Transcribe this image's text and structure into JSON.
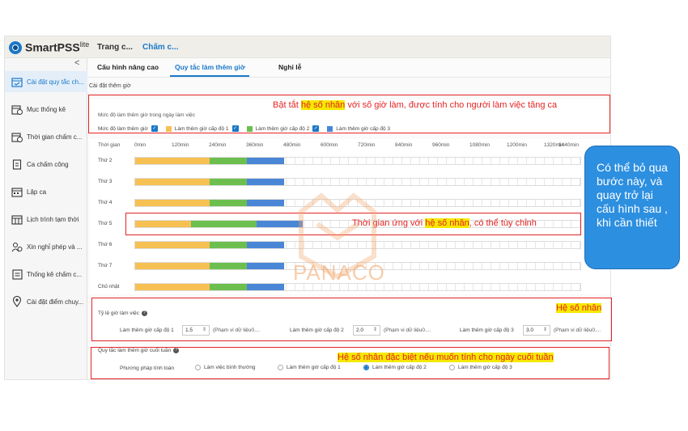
{
  "app": {
    "brand": "SmartPSS",
    "brand_sup": "lite",
    "tabs": [
      "Trang c...",
      "Chấm c..."
    ]
  },
  "sidebar": {
    "collapse_glyph": "<",
    "items": [
      {
        "label": "Cài đặt quy tắc ch...",
        "icon": "calendar-check-icon",
        "active": true
      },
      {
        "label": "Mục thống kê",
        "icon": "calendar-clock-icon"
      },
      {
        "label": "Thời gian chấm c...",
        "icon": "calendar-clock-icon"
      },
      {
        "label": "Ca chấm công",
        "icon": "clipboard-icon"
      },
      {
        "label": "Lập ca",
        "icon": "calendar-grid-icon"
      },
      {
        "label": "Lịch trình tạm thời",
        "icon": "calendar-grid-icon"
      },
      {
        "label": "Xin nghỉ phép và ...",
        "icon": "people-icon"
      },
      {
        "label": "Thống kê chấm c...",
        "icon": "report-icon"
      },
      {
        "label": "Cài đặt điểm chuy...",
        "icon": "location-pin-icon"
      }
    ]
  },
  "subtabs": [
    "Cấu hình nâng cao",
    "Quy tắc làm thêm giờ",
    "Nghỉ lễ"
  ],
  "section_title": "Cài đặt thêm giờ",
  "daily": {
    "label": "Mức độ làm thêm giờ trong ngày làm việc",
    "row_label": "Mức độ làm thêm giờ",
    "levels": [
      {
        "name": "Làm thêm giờ cấp độ 1",
        "color": "#f7c052"
      },
      {
        "name": "Làm thêm giờ cấp độ 2",
        "color": "#6cbf4f"
      },
      {
        "name": "Làm thêm giờ cấp độ 3",
        "color": "#4a86d6"
      }
    ]
  },
  "timeline": {
    "header": "Thời gian",
    "ticks": [
      "0min",
      "120min",
      "240min",
      "360min",
      "480min",
      "600min",
      "720min",
      "840min",
      "960min",
      "1080min",
      "1200min",
      "1320min",
      "1440min"
    ],
    "days": [
      {
        "name": "Thứ 2",
        "segments": [
          [
            0,
            240,
            0
          ],
          [
            240,
            360,
            1
          ],
          [
            360,
            480,
            2
          ]
        ]
      },
      {
        "name": "Thứ 3",
        "segments": [
          [
            0,
            240,
            0
          ],
          [
            240,
            360,
            1
          ],
          [
            360,
            480,
            2
          ]
        ]
      },
      {
        "name": "Thứ 4",
        "segments": [
          [
            0,
            240,
            0
          ],
          [
            240,
            360,
            1
          ],
          [
            360,
            480,
            2
          ]
        ]
      },
      {
        "name": "Thứ 5",
        "segments": [
          [
            0,
            180,
            0
          ],
          [
            180,
            390,
            1
          ],
          [
            390,
            540,
            2
          ]
        ]
      },
      {
        "name": "Thứ 6",
        "segments": [
          [
            0,
            240,
            0
          ],
          [
            240,
            360,
            1
          ],
          [
            360,
            480,
            2
          ]
        ]
      },
      {
        "name": "Thứ 7",
        "segments": [
          [
            0,
            240,
            0
          ],
          [
            240,
            360,
            1
          ],
          [
            360,
            480,
            2
          ]
        ]
      },
      {
        "name": "Chủ nhật",
        "segments": [
          [
            0,
            240,
            0
          ],
          [
            240,
            360,
            1
          ],
          [
            360,
            480,
            2
          ]
        ]
      }
    ]
  },
  "ratio": {
    "title": "Tỷ lệ giờ làm việc",
    "fields": [
      {
        "label": "Làm thêm giờ cấp độ 1",
        "value": "1.5",
        "range": "(Phạm vi dữ liệu0...."
      },
      {
        "label": "Làm thêm giờ cấp độ 2",
        "value": "2.0",
        "range": "(Phạm vi dữ liệu0...."
      },
      {
        "label": "Làm thêm giờ cấp độ 3",
        "value": "3.0",
        "range": "(Phạm vi dữ liệu0...."
      }
    ]
  },
  "weekend": {
    "title": "Quy tắc làm thêm giờ cuối tuần",
    "method_label": "Phương pháp tính toán",
    "options": [
      "Làm việc bình thường",
      "Làm thêm giờ cấp độ 1",
      "Làm thêm giờ cấp độ 2",
      "Làm thêm giờ cấp độ 3"
    ],
    "selected": 2
  },
  "annotations": {
    "note1_pre": "Bật tắt ",
    "note1_hl": "hệ số nhân",
    "note1_post": " với số giờ làm, được tính cho người làm việc tăng ca",
    "note2_pre": "Thời gian ứng với ",
    "note2_hl": "hệ số nhân",
    "note2_post": ", có thể tùy chỉnh",
    "note3": "Hệ số nhân",
    "note4": "Hệ số nhân đặc biệt nếu muốn tính cho ngày cuối tuần",
    "watermark": "PANACO",
    "bubble": "Có thể bỏ qua bước này, và quay trở lại cấu hình sau , khi cần thiết"
  },
  "colors": {
    "accent": "#1a78c8",
    "annotation": "#e52323",
    "highlight": "#f5e800",
    "bubble": "#2d8fe0"
  }
}
